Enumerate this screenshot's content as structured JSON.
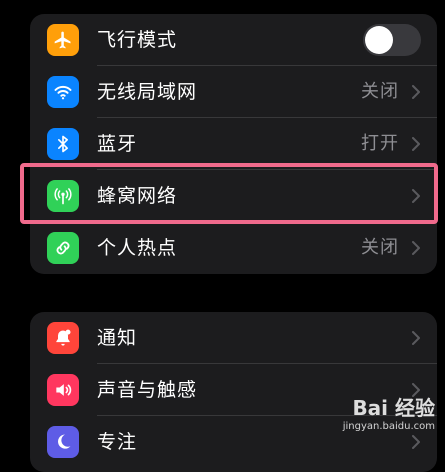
{
  "section1": {
    "airplane": {
      "label": "飞行模式",
      "icon": "airplane-icon",
      "color": "#ff9f0a",
      "toggle_on": false
    },
    "wifi": {
      "label": "无线局域网",
      "value": "关闭",
      "icon": "wifi-icon",
      "color": "#0a84ff"
    },
    "bluetooth": {
      "label": "蓝牙",
      "value": "打开",
      "icon": "bluetooth-icon",
      "color": "#0a84ff"
    },
    "cellular": {
      "label": "蜂窝网络",
      "icon": "cellular-antenna-icon",
      "color": "#30d158"
    },
    "hotspot": {
      "label": "个人热点",
      "value": "关闭",
      "icon": "hotspot-chain-icon",
      "color": "#30d158"
    }
  },
  "section2": {
    "notifications": {
      "label": "通知",
      "icon": "bell-icon",
      "color": "#ff453a"
    },
    "sounds": {
      "label": "声音与触感",
      "icon": "speaker-icon",
      "color": "#ff375f"
    },
    "focus": {
      "label": "专注",
      "icon": "moon-icon",
      "color": "#5e5ce6"
    }
  },
  "highlight_color": "#f06a8c",
  "watermark": {
    "brand": "Bai 经验",
    "url": "jingyan.baidu.com"
  }
}
